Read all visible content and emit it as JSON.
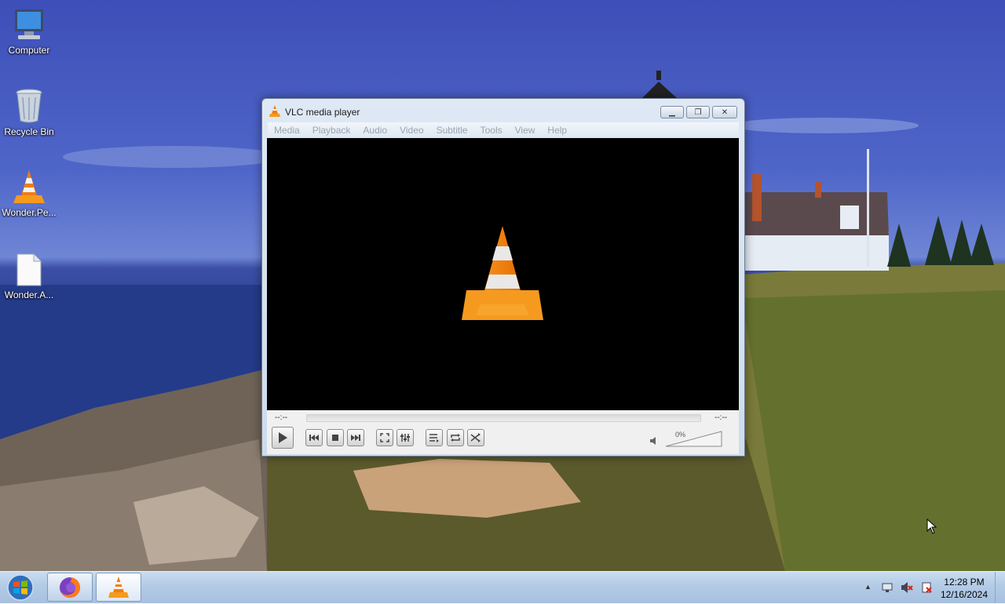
{
  "desktop": {
    "icons": [
      {
        "label": "Computer",
        "icon": "computer-icon"
      },
      {
        "label": "Recycle Bin",
        "icon": "recycle-bin-icon"
      },
      {
        "label": "Wonder.Pe...",
        "icon": "vlc-file-icon"
      },
      {
        "label": "Wonder.A...",
        "icon": "file-icon"
      }
    ]
  },
  "vlc": {
    "title": "VLC media player",
    "menu": [
      "Media",
      "Playback",
      "Audio",
      "Video",
      "Subtitle",
      "Tools",
      "View",
      "Help"
    ],
    "time_elapsed": "--:--",
    "time_total": "--:--",
    "volume_label": "0%",
    "volume_level": 0
  },
  "taskbar": {
    "time": "12:28 PM",
    "date": "12/16/2024"
  },
  "colors": {
    "vlc_orange": "#f07d12",
    "taskbar": "#b3cbe6"
  }
}
